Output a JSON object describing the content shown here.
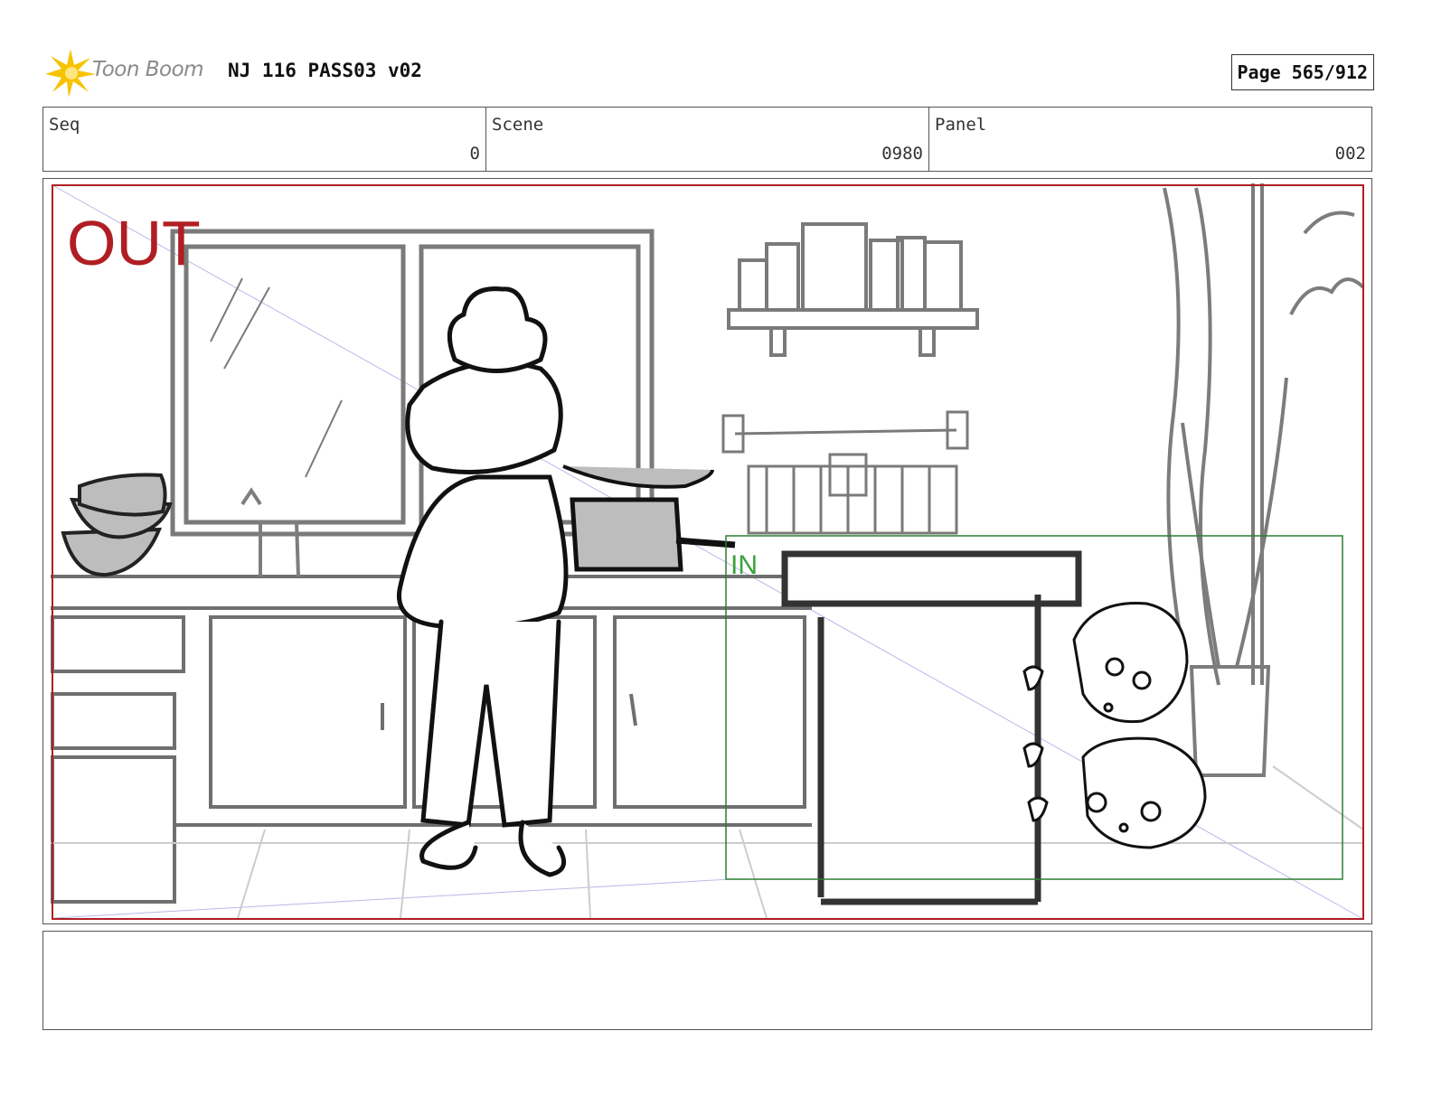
{
  "header": {
    "logo_text": "Toon Boom",
    "title": "NJ 116 PASS03 v02",
    "page_label": "Page 565/912"
  },
  "info": {
    "seq_label": "Seq",
    "seq_value": "0",
    "scene_label": "Scene",
    "scene_value": "0980",
    "panel_label": "Panel",
    "panel_value": "002"
  },
  "panel": {
    "out_label": "OUT",
    "in_label": "IN",
    "colors": {
      "out_frame": "#b01e24",
      "in_frame": "#2e7d32",
      "in_text": "#3aa33a",
      "sketch": "#777777"
    }
  },
  "notes": {
    "text": ""
  }
}
